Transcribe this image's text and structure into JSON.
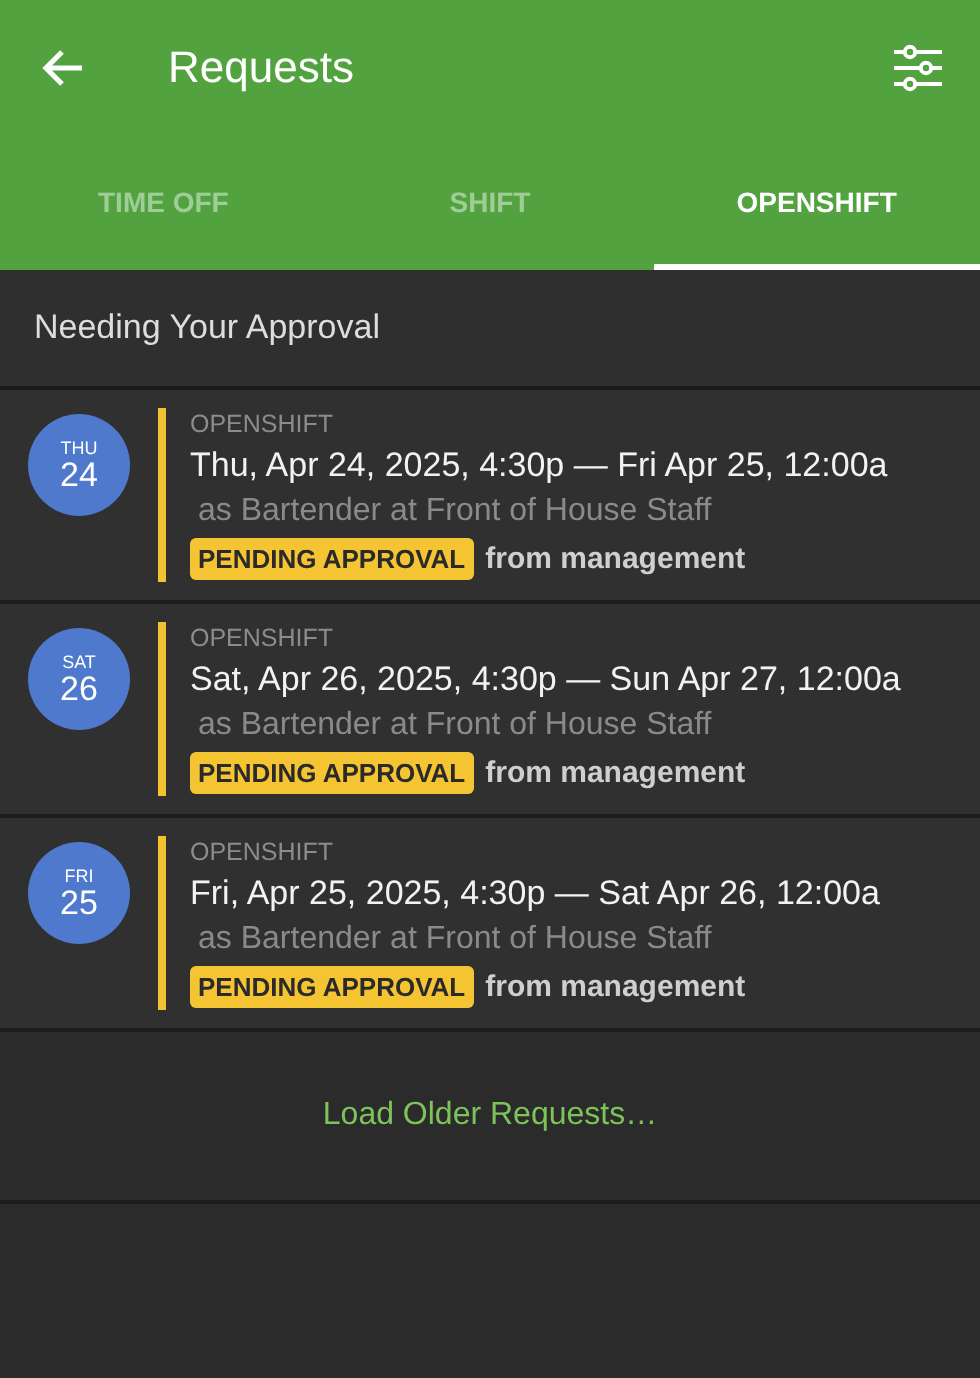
{
  "app_bar": {
    "title": "Requests"
  },
  "tabs": [
    {
      "label": "TIME OFF",
      "selected": false
    },
    {
      "label": "SHIFT",
      "selected": false
    },
    {
      "label": "OPENSHIFT",
      "selected": true
    }
  ],
  "section_title": "Needing Your Approval",
  "requests": [
    {
      "weekday": "THU",
      "day": "24",
      "type": "OPENSHIFT",
      "time": "Thu, Apr 24, 2025, 4:30p — Fri Apr 25, 12:00a",
      "detail": "as Bartender at Front of House Staff",
      "status": "PENDING APPROVAL",
      "source": "from management"
    },
    {
      "weekday": "SAT",
      "day": "26",
      "type": "OPENSHIFT",
      "time": "Sat, Apr 26, 2025, 4:30p — Sun Apr 27, 12:00a",
      "detail": "as Bartender at Front of House Staff",
      "status": "PENDING APPROVAL",
      "source": "from management"
    },
    {
      "weekday": "FRI",
      "day": "25",
      "type": "OPENSHIFT",
      "time": "Fri, Apr 25, 2025, 4:30p — Sat Apr 26, 12:00a",
      "detail": "as Bartender at Front of House Staff",
      "status": "PENDING APPROVAL",
      "source": "from management"
    }
  ],
  "load_more": "Load Older Requests…"
}
